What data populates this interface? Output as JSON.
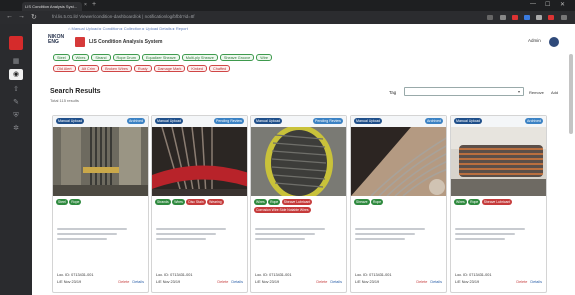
{
  "browser": {
    "tab_title": "LIS Condition Analysis Syst...",
    "url": "fnl.lis.5.01.lit/ Viewer/condition-dashboard/ok | notificationlog/bfbb?id=8f",
    "back": "←",
    "forward": "→",
    "reload": "↻",
    "min": "—",
    "max": "☐",
    "close": "✕",
    "newtab": "+",
    "tab_close": "×"
  },
  "header": {
    "breadcrumb": "⌂ Manual Upload ▸ Condition ▸ Collection ▸ Upload Details ▸ Report",
    "brand_line1": "NIKON",
    "brand_line2": "ENG",
    "app_title": "LIS Condition Analysis System",
    "user": "Admin"
  },
  "filters_green": [
    "Steel",
    "Wires",
    "Strand",
    "Rope Drum",
    "Equalizer Sheave",
    "Multi-ply Sheave",
    "Sheave Groove",
    "Wire"
  ],
  "filters_red": [
    "Old Alert",
    "Alt Crim",
    "Broken Wires",
    "Rusty",
    "Damage Mark",
    "Kinked",
    "Chaffed"
  ],
  "search": {
    "title": "Search Results",
    "count": "Total 115 results",
    "tag_label": "Tag",
    "remove": "Remove",
    "add": "Add"
  },
  "cards": [
    {
      "source": "Manual Upload",
      "status": "Archived",
      "status_color": "#3b82c4",
      "tags": [
        {
          "t": "Steel",
          "c": "green"
        },
        {
          "t": "Rope",
          "c": "green"
        }
      ],
      "loc": "Loc. ID: 0713431-001",
      "date": "L/E Nov 23/19",
      "delete": "Delete",
      "details": "Details"
    },
    {
      "source": "Manual Upload",
      "status": "Pending Review",
      "status_color": "#3b82c4",
      "tags": [
        {
          "t": "Strands",
          "c": "green"
        },
        {
          "t": "Wires",
          "c": "green"
        },
        {
          "t": "Disc Stain",
          "c": "red"
        },
        {
          "t": "Wearing",
          "c": "red"
        }
      ],
      "loc": "Loc. ID: 0713431-001",
      "date": "L/E Nov 23/19",
      "delete": "Delete",
      "details": "Details"
    },
    {
      "source": "Manual Upload",
      "status": "Pending Review",
      "status_color": "#3b82c4",
      "tags": [
        {
          "t": "Wires",
          "c": "green"
        },
        {
          "t": "Rope",
          "c": "green"
        },
        {
          "t": "Sheave Lubricant",
          "c": "red"
        },
        {
          "t": "Corrosion Wire Side Notable Wires",
          "c": "red"
        }
      ],
      "loc": "Loc. ID: 0713431-001",
      "date": "L/E Nov 23/19",
      "delete": "Delete",
      "details": "Details"
    },
    {
      "source": "Manual Upload",
      "status": "Archived",
      "status_color": "#3b82c4",
      "tags": [
        {
          "t": "Sheave",
          "c": "green"
        },
        {
          "t": "Rope",
          "c": "green"
        }
      ],
      "loc": "Loc. ID: 0713431-001",
      "date": "L/E Nov 23/19",
      "delete": "Delete",
      "details": "Details"
    },
    {
      "source": "Manual Upload",
      "status": "Archived",
      "status_color": "#3b82c4",
      "tags": [
        {
          "t": "Wires",
          "c": "green"
        },
        {
          "t": "Rope",
          "c": "green"
        },
        {
          "t": "Sheave Lubricant",
          "c": "red"
        }
      ],
      "loc": "Loc. ID: 0713431-001",
      "date": "L/E Nov 23/19",
      "delete": "Delete",
      "details": "Details"
    }
  ],
  "rail_icons": [
    "logo-icon",
    "grid-icon",
    "camera-icon",
    "upload-icon",
    "wrench-icon",
    "shield-icon",
    "settings-icon"
  ]
}
